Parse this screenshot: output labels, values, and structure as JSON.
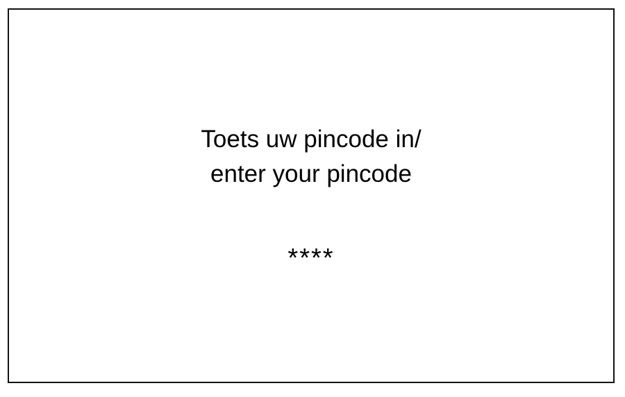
{
  "prompt": {
    "line1": "Toets uw pincode in/",
    "line2": "enter your pincode"
  },
  "pin": {
    "masked_value": "****"
  },
  "colors": {
    "background": "#ffffff",
    "border": "#111111",
    "text": "#000000"
  }
}
